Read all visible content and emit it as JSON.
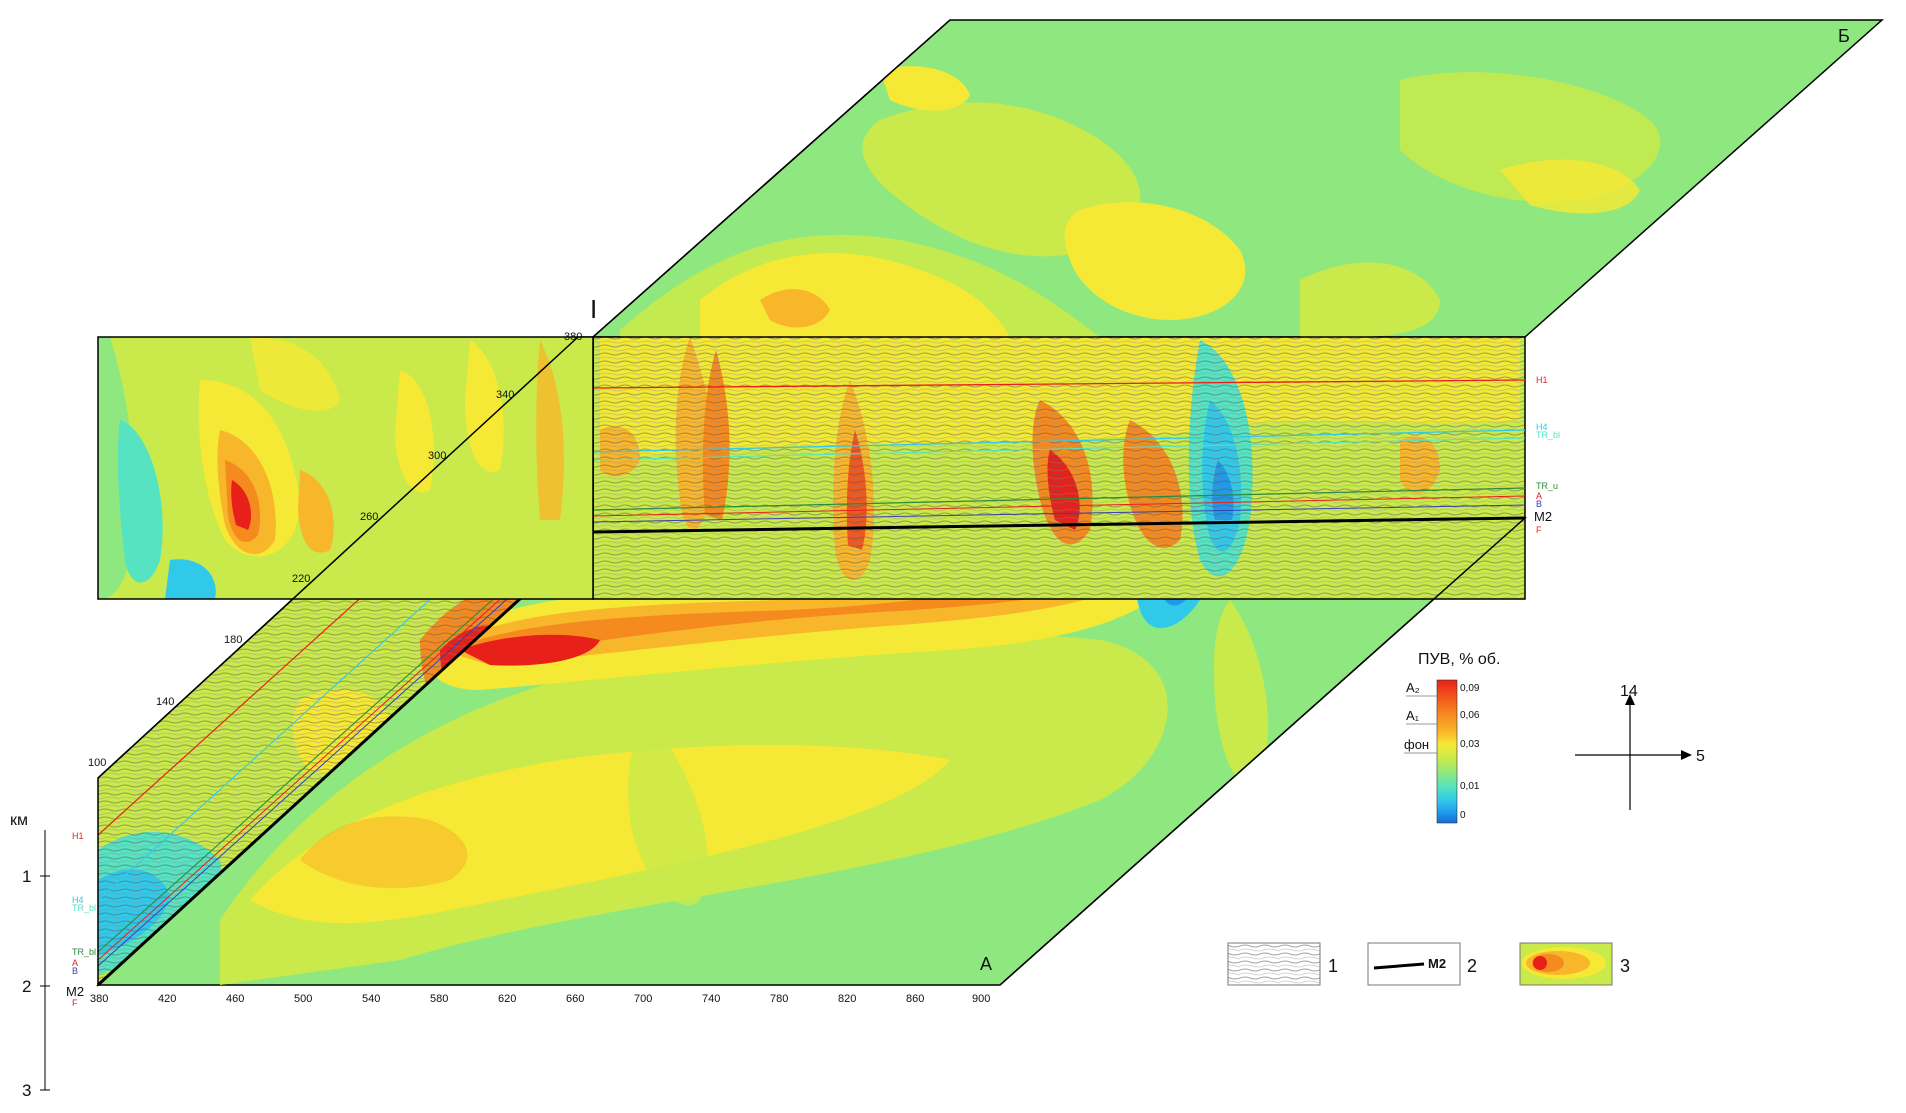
{
  "corners": {
    "a": "А",
    "b": "Б"
  },
  "section_label": "I",
  "km_axis": {
    "unit": "км",
    "ticks": [
      "1",
      "2",
      "3"
    ]
  },
  "bottom_ticks": [
    "380",
    "420",
    "460",
    "500",
    "540",
    "580",
    "620",
    "660",
    "700",
    "740",
    "780",
    "820",
    "860",
    "900"
  ],
  "left_face_ticks": [
    "100",
    "140",
    "180",
    "220",
    "260",
    "300",
    "340",
    "380"
  ],
  "horizons_right": [
    "H1",
    "H4",
    "TR_bl",
    "TR_u",
    "A",
    "B",
    "M2",
    "F"
  ],
  "horizons_left": [
    "H1",
    "H4",
    "TR_bl",
    "TR_bl",
    "A",
    "B",
    "M2",
    "F"
  ],
  "colorscale": {
    "title": "ПУВ, % об.",
    "markers": [
      "A₂",
      "A₁",
      "фон"
    ],
    "ticks": [
      "0,09",
      "0,06",
      "0,03",
      "0,01",
      "0"
    ],
    "colors": [
      "#e8201a",
      "#f2561c",
      "#f58a1f",
      "#f8b62a",
      "#f6e935",
      "#c9ea4a",
      "#8ee880",
      "#55e3c1",
      "#31c9ea",
      "#1f99ea",
      "#1969d6"
    ]
  },
  "compass": {
    "north": "14",
    "east": "5"
  },
  "legend": [
    {
      "num": "1"
    },
    {
      "num": "2",
      "text": "M2"
    },
    {
      "num": "3"
    }
  ],
  "colors": {
    "background": "#ffffff",
    "base": "#8fe87f",
    "outline": "#000000"
  }
}
